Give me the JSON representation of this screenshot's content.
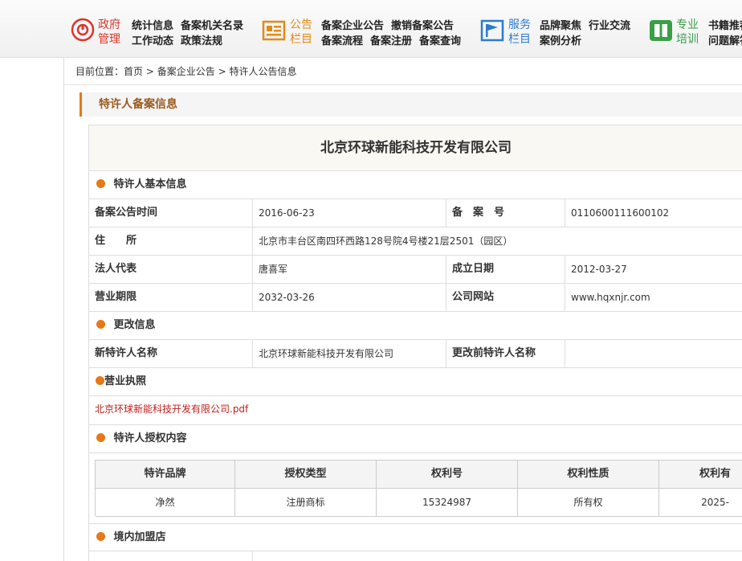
{
  "topnav": {
    "gov": {
      "title_line1": "政府",
      "title_line2": "管理",
      "links_row1": [
        "统计信息",
        "备案机关名录"
      ],
      "links_row2": [
        "工作动态",
        "政策法规"
      ]
    },
    "notice": {
      "title_line1": "公告",
      "title_line2": "栏目",
      "links_row1": [
        "备案企业公告",
        "撤销备案公告"
      ],
      "links_row2": [
        "备案流程",
        "备案注册",
        "备案查询"
      ]
    },
    "service": {
      "title_line1": "服务",
      "title_line2": "栏目",
      "links_row1": [
        "品牌聚焦",
        "行业交流"
      ],
      "links_row2": [
        "案例分析"
      ]
    },
    "training": {
      "title_line1": "专业",
      "title_line2": "培训",
      "links_row1": [
        "书籍推荐"
      ],
      "links_row2": [
        "问题解答"
      ]
    }
  },
  "breadcrumb": {
    "label": "目前位置：",
    "items": [
      "首页",
      "备案企业公告",
      "特许人公告信息"
    ],
    "sep": ">"
  },
  "section_title": "特许人备案信息",
  "company_name": "北京环球新能科技开发有限公司",
  "basic": {
    "heading": "特许人基本信息",
    "rows": [
      {
        "l1": "备案公告时间",
        "v1": "2016-06-23",
        "l2": "备　案　号",
        "v2": "0110600111600102"
      },
      {
        "l1": "住　　所",
        "v1": "北京市丰台区南四环西路128号院4号楼21层2501（园区）"
      },
      {
        "l1": "法人代表",
        "v1": "唐喜军",
        "l2": "成立日期",
        "v2": "2012-03-27"
      },
      {
        "l1": "营业期限",
        "v1": "2032-03-26",
        "l2": "公司网站",
        "v2": "www.hqxnjr.com"
      }
    ]
  },
  "change": {
    "heading": "更改信息",
    "l1": "新特许人名称",
    "v1": "北京环球新能科技开发有限公司",
    "l2": "更改前特许人名称",
    "v2": ""
  },
  "license": {
    "heading": "营业执照",
    "file": "北京环球新能科技开发有限公司.pdf"
  },
  "rights": {
    "heading": "特许人授权内容",
    "columns": [
      "特许品牌",
      "授权类型",
      "权利号",
      "权利性质",
      "权利有"
    ],
    "row": [
      "净然",
      "注册商标",
      "15324987",
      "所有权",
      "2025-"
    ]
  },
  "franchise": {
    "heading": "境内加盟店"
  },
  "colors": {
    "accent": "#e67817",
    "link": "#c0201c",
    "gov": "#d9372c",
    "notice": "#e08a18",
    "service": "#2c7bd0",
    "training": "#39a046"
  }
}
